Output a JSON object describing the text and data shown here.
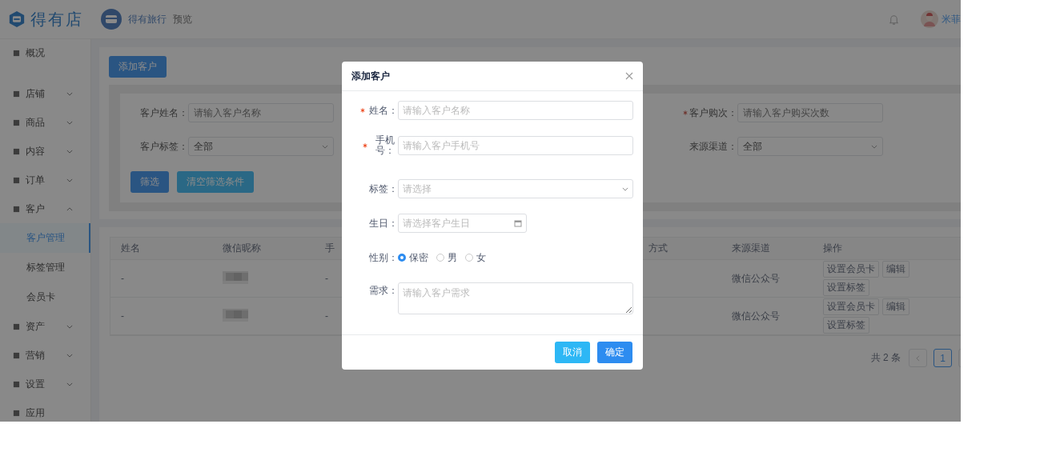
{
  "header": {
    "logo": "得有店",
    "store_name": "得有旅行",
    "preview": "预览",
    "username": "米菲"
  },
  "sidebar": {
    "items": [
      {
        "label": "概况"
      },
      {
        "label": "店铺",
        "expanded": false
      },
      {
        "label": "商品",
        "expanded": false
      },
      {
        "label": "内容",
        "expanded": false
      },
      {
        "label": "订单",
        "expanded": false
      },
      {
        "label": "客户",
        "expanded": true,
        "children": [
          {
            "label": "客户管理",
            "selected": true
          },
          {
            "label": "标签管理",
            "selected": false
          },
          {
            "label": "会员卡",
            "selected": false
          }
        ]
      },
      {
        "label": "资产",
        "expanded": false
      },
      {
        "label": "营销",
        "expanded": false
      },
      {
        "label": "设置",
        "expanded": false
      },
      {
        "label": "应用"
      }
    ]
  },
  "add_button": "添加客户",
  "filters": {
    "fields": [
      {
        "label": "客户姓名：",
        "kind": "input",
        "placeholder": "请输入客户名称",
        "required": false
      },
      {
        "label": "客户购次：",
        "kind": "input",
        "placeholder": "请输入客户购买次数",
        "required": true
      },
      {
        "label": "客户标签：",
        "kind": "select",
        "value": "全部",
        "required": false
      },
      {
        "label": "来源渠道：",
        "kind": "select",
        "value": "全部",
        "required": false
      }
    ],
    "buttons": [
      {
        "label": "筛选",
        "kind": "primary"
      },
      {
        "label": "清空筛选条件",
        "kind": "info"
      }
    ]
  },
  "table": {
    "columns": [
      "姓名",
      "微信昵称",
      "手",
      "方式",
      "来源渠道",
      "操作"
    ],
    "rows": [
      {
        "name": "-",
        "nickname": {
          "kind": "picture"
        },
        "phone": "-",
        "source": "微信公众号",
        "actions": [
          "设置会员卡",
          "编辑",
          "设置标签"
        ]
      },
      {
        "name": "-",
        "nickname": {
          "kind": "picture"
        },
        "phone": "-",
        "source": "微信公众号",
        "actions": [
          "设置会员卡",
          "编辑",
          "设置标签"
        ]
      }
    ]
  },
  "pagination": {
    "total": "共 2 条",
    "pages": [
      {
        "label": "1",
        "selected": true
      }
    ]
  },
  "dialog": {
    "title": "添加客户",
    "fields": [
      {
        "label": "姓名：",
        "kind": "input",
        "placeholder": "请输入客户名称",
        "required": true
      },
      {
        "label": "手机号：",
        "kind": "input",
        "placeholder": "请输入客户手机号",
        "required": true
      },
      {
        "label": "标签：",
        "kind": "select",
        "placeholder": "请选择",
        "required": false
      },
      {
        "label": "生日：",
        "kind": "date",
        "placeholder": "请选择客户生日",
        "required": false
      },
      {
        "label": "性别：",
        "kind": "radio",
        "required": false,
        "options": [
          {
            "label": "保密",
            "selected": true
          },
          {
            "label": "男",
            "selected": false
          },
          {
            "label": "女",
            "selected": false
          }
        ]
      },
      {
        "label": "需求：",
        "kind": "textarea",
        "placeholder": "请输入客户需求",
        "required": false
      }
    ],
    "buttons": [
      {
        "label": "取消",
        "kind": "info"
      },
      {
        "label": "确定",
        "kind": "primary"
      }
    ]
  }
}
